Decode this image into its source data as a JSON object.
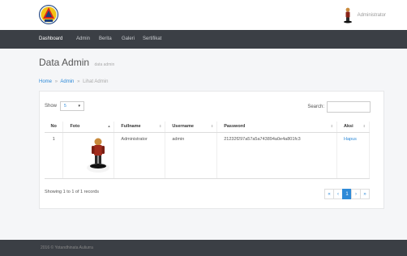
{
  "header": {
    "user_name": "Administrator",
    "logo_icon": "organization-logo-icon",
    "avatar_icon": "figure-avatar-icon"
  },
  "nav": {
    "items": [
      {
        "label": "Dashboard",
        "active": true
      },
      {
        "label": "Admin",
        "active": false
      },
      {
        "label": "Berita",
        "active": false
      },
      {
        "label": "Galeri",
        "active": false
      },
      {
        "label": "Sertifikat",
        "active": false
      }
    ]
  },
  "page": {
    "title": "Data Admin",
    "subtitle": "data admin"
  },
  "breadcrumb": {
    "items": [
      "Home",
      "Admin",
      "Lihat Admin"
    ],
    "separator": "»"
  },
  "controls": {
    "show_label": "Show",
    "show_value": "5",
    "search_label": "Search:",
    "search_value": ""
  },
  "table": {
    "headers": [
      "No",
      "Foto",
      "Fullname",
      "Username",
      "Password",
      "Aksi"
    ],
    "rows": [
      {
        "no": "1",
        "foto": "figure-photo",
        "fullname": "Administrator",
        "username": "admin",
        "password": "21232f297a57a5a743894a0e4a801fc3",
        "aksi": "Hapus"
      }
    ]
  },
  "records_info": "Showing 1 to 1 of 1 records",
  "pagination": {
    "first": "«",
    "prev": "‹",
    "current": "1",
    "next": "›",
    "last": "»"
  },
  "footer": {
    "text": "2016 © Yotandhinata Auliurra"
  },
  "colors": {
    "accent": "#2e8ad8",
    "navbar": "#3b3f45",
    "background": "#f5f6f8"
  }
}
